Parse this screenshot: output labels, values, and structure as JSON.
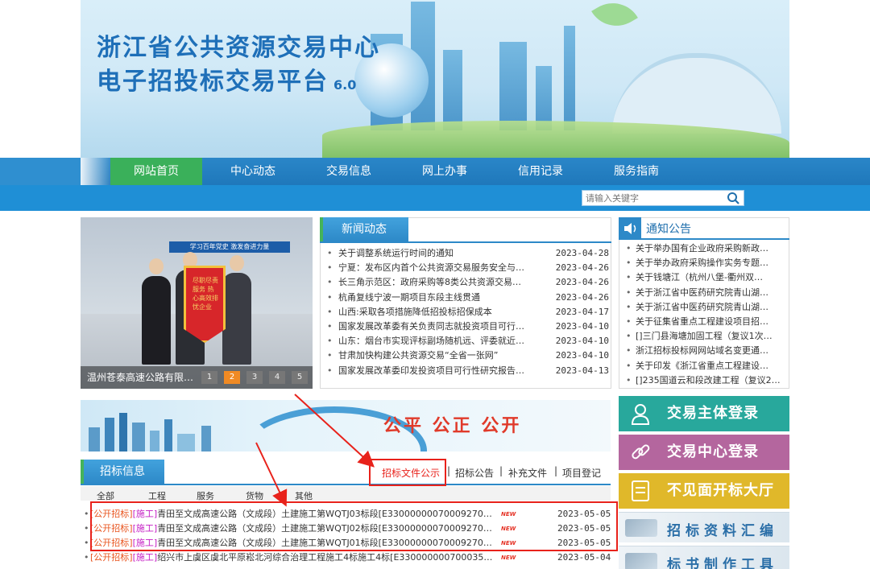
{
  "banner": {
    "title_line1": "浙江省公共资源交易中心",
    "title_line2": "电子招投标交易平台",
    "version": "6.0"
  },
  "nav": {
    "items": [
      {
        "label": "网站首页",
        "active": true
      },
      {
        "label": "中心动态",
        "active": false
      },
      {
        "label": "交易信息",
        "active": false
      },
      {
        "label": "网上办事",
        "active": false
      },
      {
        "label": "信用记录",
        "active": false
      },
      {
        "label": "服务指南",
        "active": false
      }
    ]
  },
  "search": {
    "placeholder": "请输入关键字",
    "icon": "search-icon"
  },
  "slideshow": {
    "caption": "温州苍泰高速公路有限…",
    "pennant_text": "尽职尽责服务 热心高效排忧企业",
    "sign_text": "学习百年党史 激发奋进力量",
    "pages": [
      "1",
      "2",
      "3",
      "4",
      "5"
    ],
    "active_page": 2
  },
  "news": {
    "tab": "新闻动态",
    "items": [
      {
        "title": "关于调整系统运行时间的通知",
        "date": "2023-04-28"
      },
      {
        "title": "宁夏：发布区内首个公共资源交易服务安全与…",
        "date": "2023-04-26"
      },
      {
        "title": "长三角示范区：政府采购等8类公共资源交易…",
        "date": "2023-04-26"
      },
      {
        "title": "杭甬复线宁波一期项目东段主线贯通",
        "date": "2023-04-26"
      },
      {
        "title": "山西:采取各项措施降低招投标招保成本",
        "date": "2023-04-17"
      },
      {
        "title": "国家发展改革委有关负责同志就投资项目可行…",
        "date": "2023-04-10"
      },
      {
        "title": "山东：烟台市实现评标副场随机远、评委就近…",
        "date": "2023-04-10"
      },
      {
        "title": "甘肃加快构建公共资源交易“全省一张网”",
        "date": "2023-04-10"
      },
      {
        "title": "国家发展改革委印发投资项目可行性研究报告…",
        "date": "2023-04-13"
      }
    ]
  },
  "notice": {
    "tab": "通知公告",
    "icon": "speaker-icon",
    "items": [
      "关于举办国有企业政府采购新政…",
      "关于举办政府采购操作实务专题…",
      "关于钱塘江（杭州八堡-衢州双…",
      "关于浙江省中医药研究院青山湖…",
      "关于浙江省中医药研究院青山湖…",
      "关于征集省重点工程建设项目招…",
      "[]三门县海塘加固工程（复议1次…",
      "浙江招标投标网网站域名变更通…",
      "关于印发《浙江省重点工程建设…",
      "[]235国道云和段改建工程（复议2…"
    ]
  },
  "side_buttons": [
    {
      "label": "交易主体登录",
      "icon": "user-icon",
      "color": "#28a89c"
    },
    {
      "label": "交易中心登录",
      "icon": "link-icon",
      "color": "#b4669e"
    },
    {
      "label": "不见面开标大厅",
      "icon": "document-icon",
      "color": "#e0b82a"
    },
    {
      "label": "招标资料汇编",
      "icon": "pen-icon"
    },
    {
      "label": "标书制作工具",
      "icon": "pen-icon"
    }
  ],
  "mid_banner": {
    "slogan": "公平  公正  公开"
  },
  "bidding": {
    "tab": "招标信息",
    "links": [
      "招标文件公示",
      "招标公告",
      "补充文件",
      "项目登记"
    ],
    "separator": "|",
    "categories": [
      "全部",
      "工程",
      "服务",
      "货物",
      "其他"
    ],
    "rows": [
      {
        "tag1": "[公开招标]",
        "tag2": "[施工]",
        "title": "青田至文成高速公路（文成段）土建施工第WQTJ03标段[E33000000070009270010…",
        "new": "NEW",
        "date": "2023-05-05"
      },
      {
        "tag1": "[公开招标]",
        "tag2": "[施工]",
        "title": "青田至文成高速公路（文成段）土建施工第WQTJ02标段[E33000000070009270010…",
        "new": "NEW",
        "date": "2023-05-05"
      },
      {
        "tag1": "[公开招标]",
        "tag2": "[施工]",
        "title": "青田至文成高速公路（文成段）土建施工第WQTJ01标段[E33000000070009270010…",
        "new": "NEW",
        "date": "2023-05-05"
      },
      {
        "tag1": "[公开招标]",
        "tag2": "[施工]",
        "title": "绍兴市上虞区虞北平原崧北河综合治理工程施工4标施工4标[E330000000700035…",
        "new": "NEW",
        "date": "2023-05-04"
      }
    ]
  },
  "colors": {
    "nav_active": "#3ab05a",
    "nav_bg": "#2a86c8",
    "annotation": "#e8221b",
    "tag_bid": "#e8541e",
    "tag_type": "#c41bc4"
  }
}
